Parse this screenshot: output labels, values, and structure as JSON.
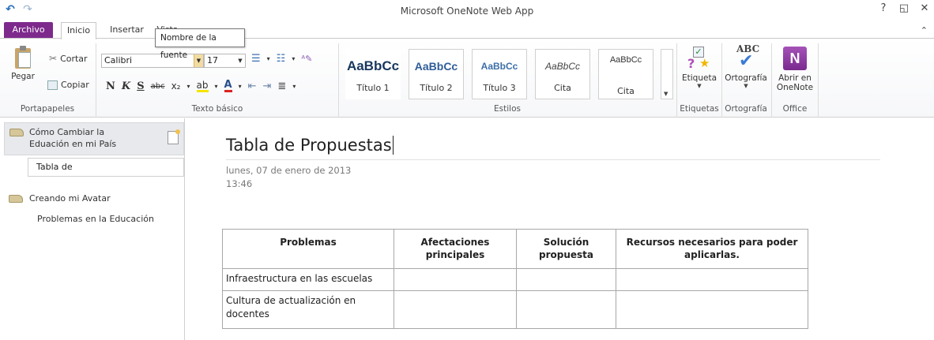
{
  "window": {
    "title": "Microsoft OneNote Web App",
    "controls": {
      "help": "?",
      "restore": "◱",
      "close": "✕",
      "collapse": "⌃"
    }
  },
  "tabs": {
    "archivo": "Archivo",
    "inicio": "Inicio",
    "insertar": "Insertar",
    "vista": "Vista"
  },
  "tooltip": "Nombre de la fuente",
  "ribbon": {
    "clipboard": {
      "paste": "Pegar",
      "cut": "Cortar",
      "copy": "Copiar",
      "group": "Portapapeles"
    },
    "font": {
      "name": "Calibri",
      "size": "17",
      "group": "Texto básico",
      "bold": "N",
      "italic": "K",
      "underline": "S",
      "strike": "abc",
      "subscript": "x₂"
    },
    "styles": {
      "group": "Estilos",
      "items": [
        {
          "sample": "AaBbCc",
          "name": "Título 1"
        },
        {
          "sample": "AaBbCc",
          "name": "Título 2"
        },
        {
          "sample": "AaBbCc",
          "name": "Título 3"
        },
        {
          "sample": "AaBbCc",
          "name": "Cita"
        },
        {
          "sample": "AaBbCc",
          "name": "Cita"
        }
      ]
    },
    "tags": {
      "button": "Etiqueta",
      "group": "Etiquetas"
    },
    "spelling": {
      "button": "Ortografía",
      "group": "Ortografía",
      "abc": "ABC"
    },
    "office": {
      "button_line1": "Abrir en",
      "button_line2": "OneNote",
      "group": "Office"
    }
  },
  "nav": {
    "sections": [
      {
        "line1": "Cómo Cambiar la",
        "line2": "Eduación en mi País"
      },
      {
        "line1": "Creando mi Avatar"
      }
    ],
    "selected_page": "Tabla de",
    "other_page": "Problemas en la Educación"
  },
  "page": {
    "title": "Tabla de Propuestas",
    "date": "lunes, 07 de enero de 2013",
    "time": "13:46"
  },
  "table": {
    "headers": [
      "Problemas",
      "Afectaciones principales",
      "Solución propuesta",
      "Recursos necesarios para poder aplicarlas."
    ],
    "rows": [
      [
        "Infraestructura en las escuelas",
        "",
        "",
        ""
      ],
      [
        "Cultura de actualización en docentes",
        "",
        "",
        ""
      ]
    ]
  }
}
